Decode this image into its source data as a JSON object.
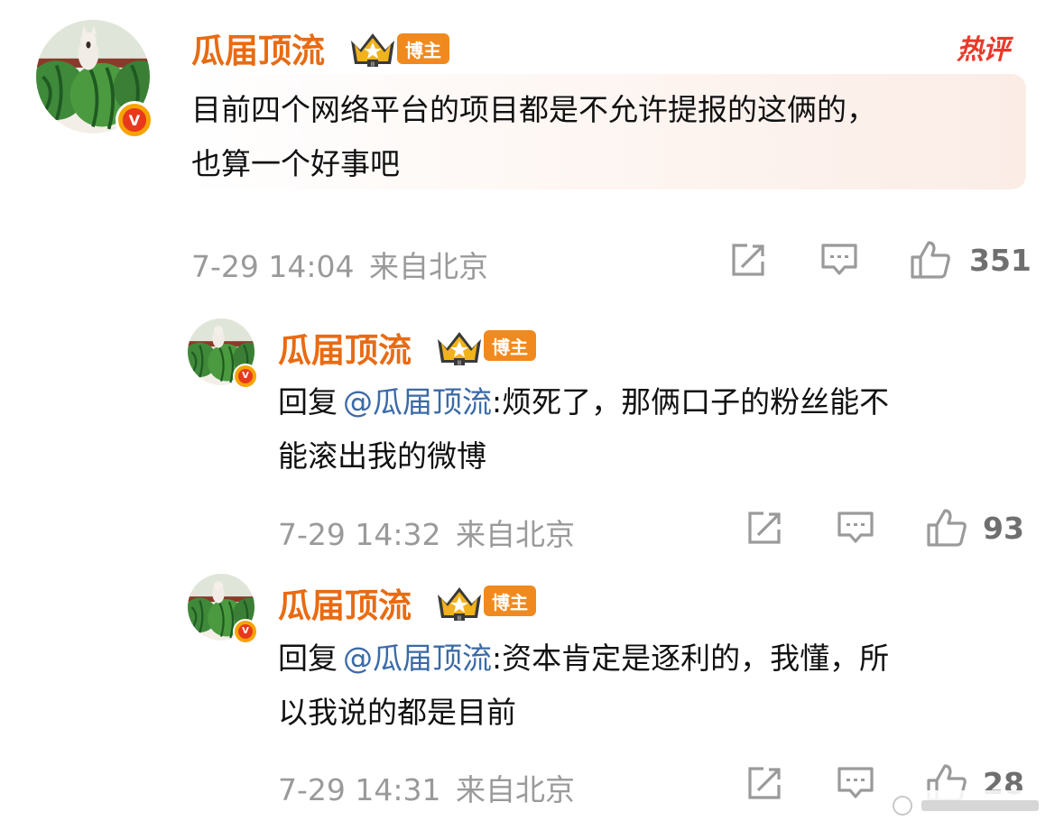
{
  "hot_tag": "热评",
  "main_comment": {
    "username": "瓜届顶流",
    "role_badge": "博主",
    "line1": "目前四个网络平台的项目都是不允许提报的这俩的，",
    "line2": "也算一个好事吧",
    "time": "7-29 14:04",
    "location": "来自北京",
    "likes": "351"
  },
  "replies": [
    {
      "username": "瓜届顶流",
      "role_badge": "博主",
      "reply_prefix": "回复",
      "mention": "@瓜届顶流",
      "line1_rest": ":烦死了，那俩口子的粉丝能不",
      "line2": "能滚出我的微博",
      "time": "7-29 14:32",
      "location": "来自北京",
      "likes": "93"
    },
    {
      "username": "瓜届顶流",
      "role_badge": "博主",
      "reply_prefix": "回复",
      "mention": "@瓜届顶流",
      "line1_rest": ":资本肯定是逐利的，我懂，所",
      "line2": "以我说的都是目前",
      "time": "7-29 14:31",
      "location": "来自北京",
      "likes": "28"
    }
  ],
  "icons": {
    "verified": "v-verified-icon",
    "crown": "crown-level-icon",
    "share": "share-icon",
    "comment": "comment-icon",
    "like": "thumbs-up-icon"
  },
  "colors": {
    "username": "#e86b13",
    "mention": "#3b6aa6",
    "hot": "#e8392b",
    "meta": "#9a9a9a",
    "badge": "#f08a1e"
  }
}
